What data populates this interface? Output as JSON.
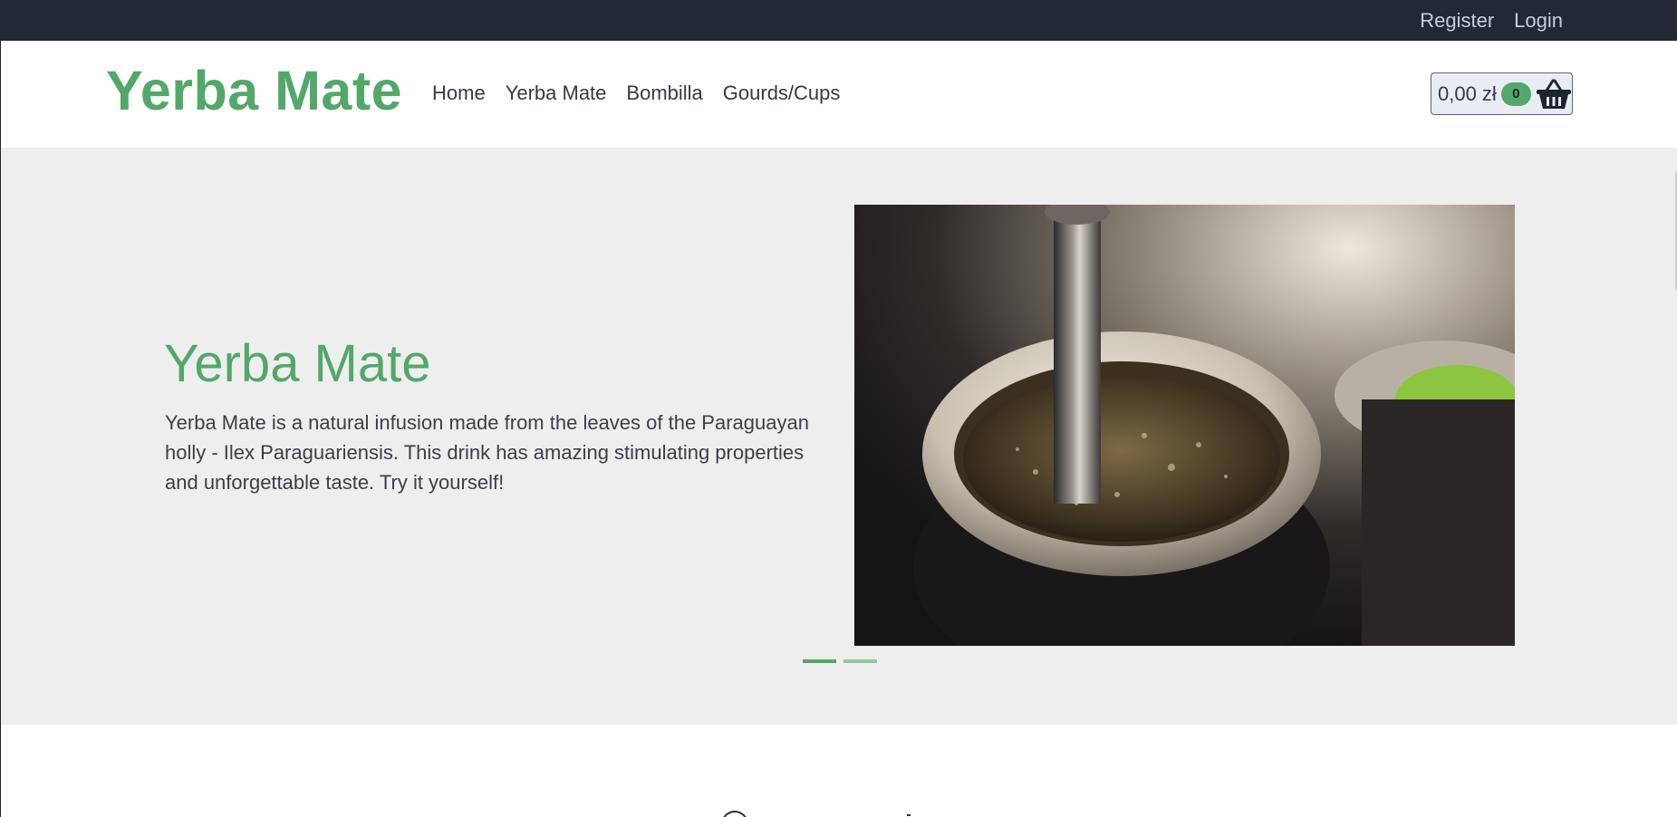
{
  "topbar": {
    "register_label": "Register",
    "login_label": "Login"
  },
  "navbar": {
    "brand": "Yerba Mate",
    "links": [
      {
        "label": "Home"
      },
      {
        "label": "Yerba Mate"
      },
      {
        "label": "Bombilla"
      },
      {
        "label": "Gourds/Cups"
      }
    ],
    "cart": {
      "total": "0,00 zł",
      "count": "0",
      "icon": "basket-icon"
    }
  },
  "hero": {
    "title": "Yerba Mate",
    "text": "Yerba Mate is a natural infusion made from the leaves of the Paraguayan holly - Ilex Paraguariensis. This drink has amazing stimulating properties and unforgettable taste. Try it yourself!",
    "image_alt": "gourd with yerba mate and bombilla",
    "slides": 2,
    "active_slide": 1
  },
  "colors": {
    "brand_green": "#52a868",
    "topbar_bg": "#212936",
    "hero_bg": "#eeeeee"
  }
}
